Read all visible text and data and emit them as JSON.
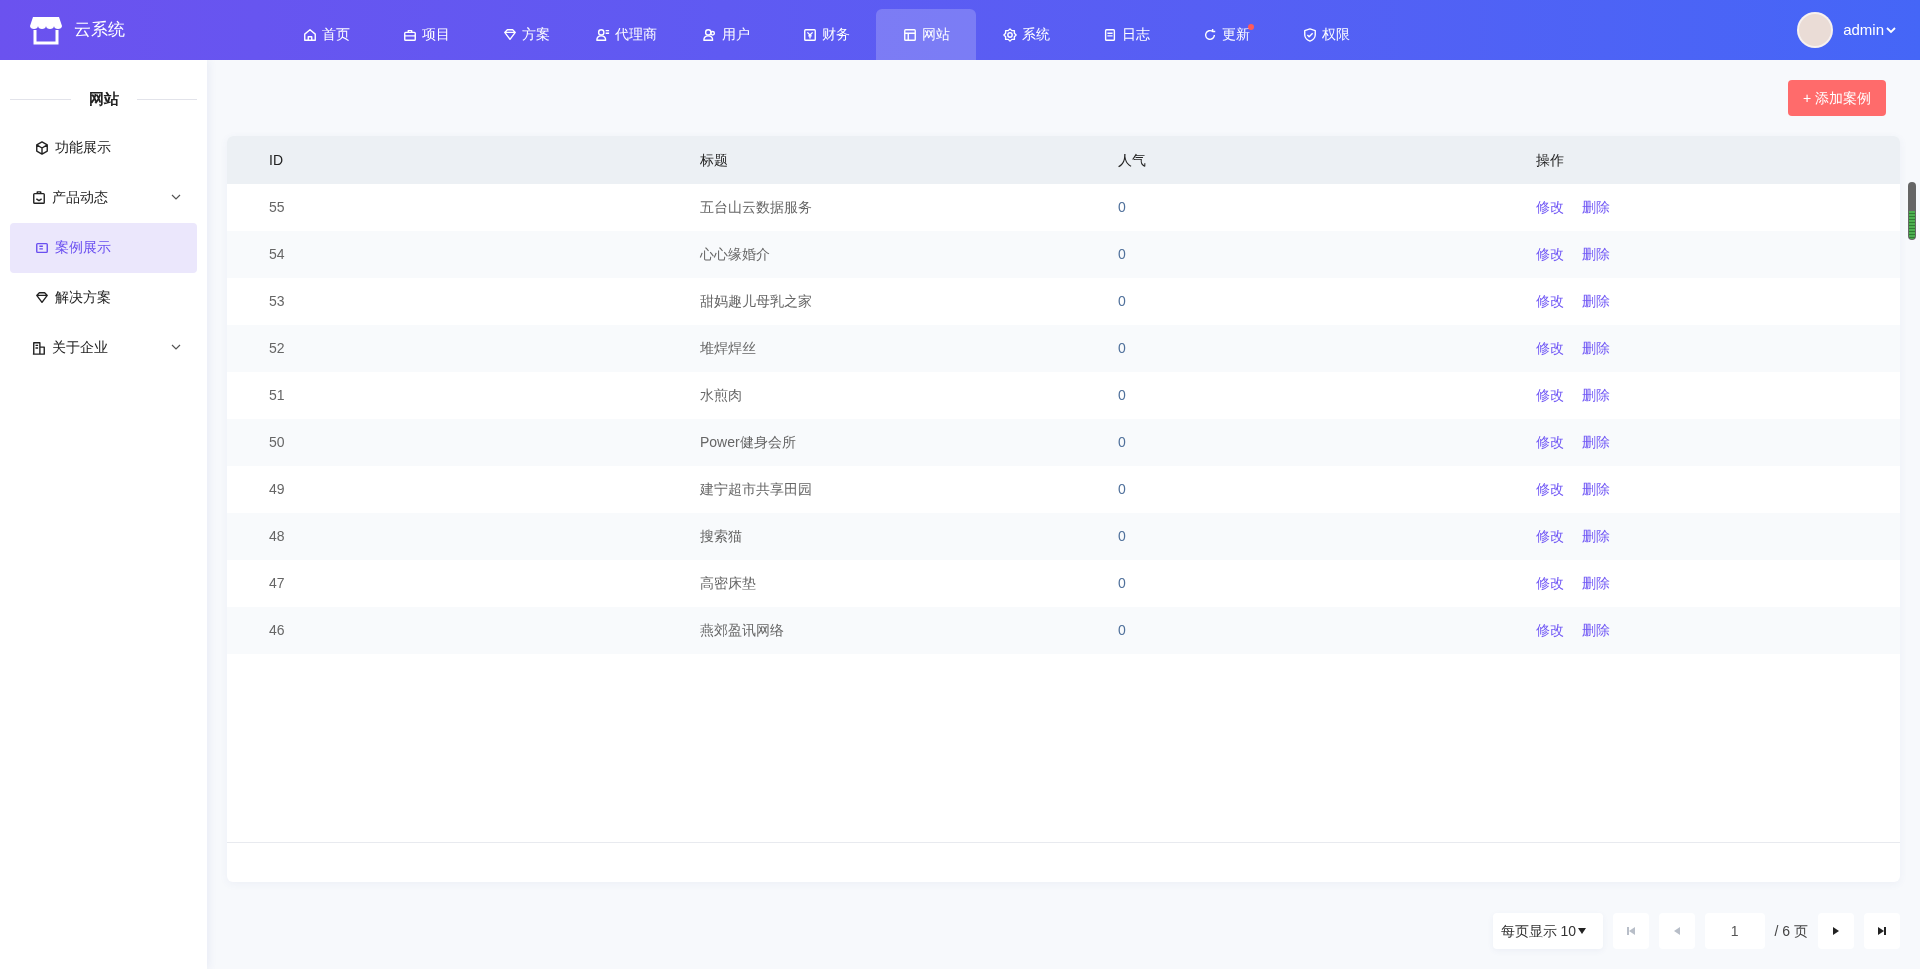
{
  "app": {
    "title": "云系统"
  },
  "nav": [
    {
      "label": "首页",
      "selected": false,
      "notify": false
    },
    {
      "label": "项目",
      "selected": false,
      "notify": false
    },
    {
      "label": "方案",
      "selected": false,
      "notify": false
    },
    {
      "label": "代理商",
      "selected": false,
      "notify": false
    },
    {
      "label": "用户",
      "selected": false,
      "notify": false
    },
    {
      "label": "财务",
      "selected": false,
      "notify": false
    },
    {
      "label": "网站",
      "selected": true,
      "notify": false
    },
    {
      "label": "系统",
      "selected": false,
      "notify": false
    },
    {
      "label": "日志",
      "selected": false,
      "notify": false
    },
    {
      "label": "更新",
      "selected": false,
      "notify": true
    },
    {
      "label": "权限",
      "selected": false,
      "notify": false
    }
  ],
  "user": {
    "name": "admin"
  },
  "sidebar": {
    "title": "网站",
    "items": [
      {
        "label": "功能展示",
        "kind": "link",
        "selected": false
      },
      {
        "label": "产品动态",
        "kind": "group",
        "selected": false
      },
      {
        "label": "案例展示",
        "kind": "link",
        "selected": true
      },
      {
        "label": "解决方案",
        "kind": "link",
        "selected": false
      },
      {
        "label": "关于企业",
        "kind": "group",
        "selected": false
      }
    ]
  },
  "add_button": "+ 添加案例",
  "table": {
    "columns": [
      "ID",
      "标题",
      "人气",
      "操作"
    ],
    "rows": [
      {
        "id": "55",
        "title": "五台山云数据服务",
        "popularity": "0",
        "actions": [
          "修改",
          "删除"
        ]
      },
      {
        "id": "54",
        "title": "心心缘婚介",
        "popularity": "0",
        "actions": [
          "修改",
          "删除"
        ]
      },
      {
        "id": "53",
        "title": "甜妈趣儿母乳之家",
        "popularity": "0",
        "actions": [
          "修改",
          "删除"
        ]
      },
      {
        "id": "52",
        "title": "堆焊焊丝",
        "popularity": "0",
        "actions": [
          "修改",
          "删除"
        ]
      },
      {
        "id": "51",
        "title": "水煎肉",
        "popularity": "0",
        "actions": [
          "修改",
          "删除"
        ]
      },
      {
        "id": "50",
        "title": "Power健身会所",
        "popularity": "0",
        "actions": [
          "修改",
          "删除"
        ]
      },
      {
        "id": "49",
        "title": "建宁超市共享田园",
        "popularity": "0",
        "actions": [
          "修改",
          "删除"
        ]
      },
      {
        "id": "48",
        "title": "搜索猫",
        "popularity": "0",
        "actions": [
          "修改",
          "删除"
        ]
      },
      {
        "id": "47",
        "title": "高密床垫",
        "popularity": "0",
        "actions": [
          "修改",
          "删除"
        ]
      },
      {
        "id": "46",
        "title": "燕郊盈讯网络",
        "popularity": "0",
        "actions": [
          "修改",
          "删除"
        ]
      }
    ]
  },
  "pagination": {
    "page_size": "每页显示 10",
    "page": "1",
    "total": "/ 6 页",
    "buttons": [
      {
        "kind": "first",
        "disabled": true
      },
      {
        "kind": "prev",
        "disabled": true
      },
      {
        "kind": "next",
        "disabled": false
      },
      {
        "kind": "last",
        "disabled": false
      }
    ]
  }
}
